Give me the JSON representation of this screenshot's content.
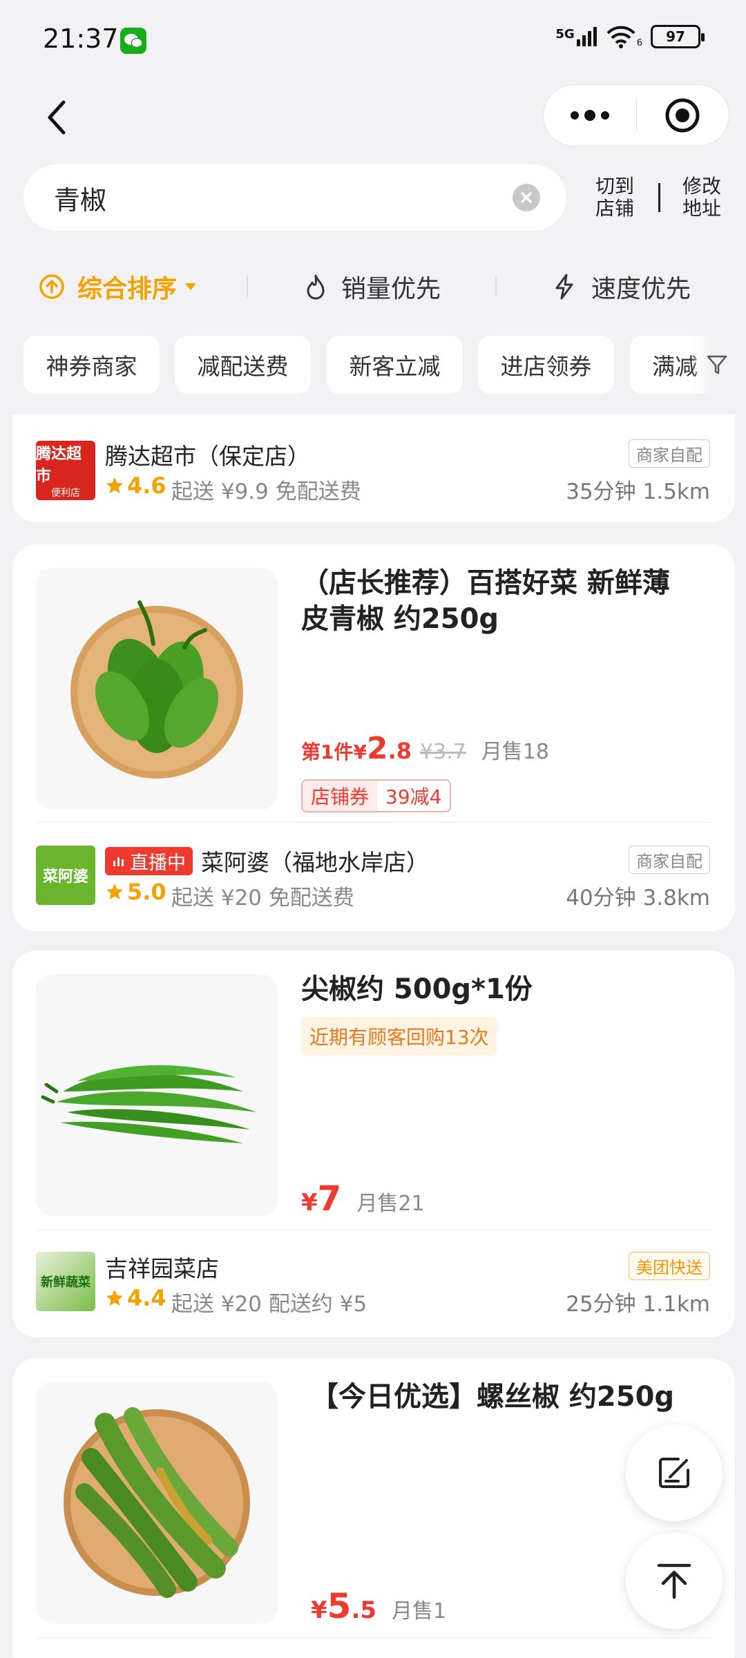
{
  "status_bar": {
    "time": "21:37",
    "network": "5G",
    "wifi_sub": "6",
    "battery": "97"
  },
  "search": {
    "query": "青椒"
  },
  "header_links": {
    "switch_shop": [
      "切到",
      "店铺"
    ],
    "change_address": [
      "修改",
      "地址"
    ]
  },
  "sort": [
    {
      "label": "综合排序",
      "active": true
    },
    {
      "label": "销量优先",
      "active": false
    },
    {
      "label": "速度优先",
      "active": false
    }
  ],
  "chips": [
    "神券商家",
    "减配送费",
    "新客立减",
    "进店领券",
    "满减"
  ],
  "shop0": {
    "name": "腾达超市（保定店）",
    "rating": "4.6",
    "delivery": "起送 ¥9.9 免配送费",
    "eta": "35分钟  1.5km",
    "tag": "商家自配",
    "logo_line1": "腾达超市",
    "logo_line2": "便利店"
  },
  "card1": {
    "title_line1": "（店长推荐）百搭好菜 新鲜薄",
    "title_line2": "皮青椒 约250g",
    "price_prefix": "第1件¥",
    "price_int": "2",
    "price_dec": ".8",
    "orig_price": "¥3.7",
    "sold": "月售18",
    "coupon_a": "店铺券",
    "coupon_b": "39减4",
    "shop": {
      "live": "直播中",
      "name": "菜阿婆（福地水岸店）",
      "rating": "5.0",
      "delivery": "起送 ¥20 免配送费",
      "eta": "40分钟  3.8km",
      "tag": "商家自配",
      "logo_text": "菜阿婆"
    }
  },
  "card2": {
    "title": "尖椒约 500g*1份",
    "repurchase": "近期有顾客回购13次",
    "price_symbol": "¥",
    "price": "7",
    "sold": "月售21",
    "shop": {
      "name": "吉祥园菜店",
      "rating": "4.4",
      "delivery": "起送 ¥20 配送约 ¥5",
      "eta": "25分钟  1.1km",
      "tag": "美团快送",
      "logo_text": "新鲜蔬菜"
    }
  },
  "card3": {
    "title": "【今日优选】螺丝椒 约250g",
    "price_symbol": "¥",
    "price_int": "5",
    "price_dec": ".5",
    "sold": "月售1"
  },
  "colors": {
    "accent": "#f5a100",
    "price": "#ee3a2f",
    "background": "#f2f2f4"
  }
}
